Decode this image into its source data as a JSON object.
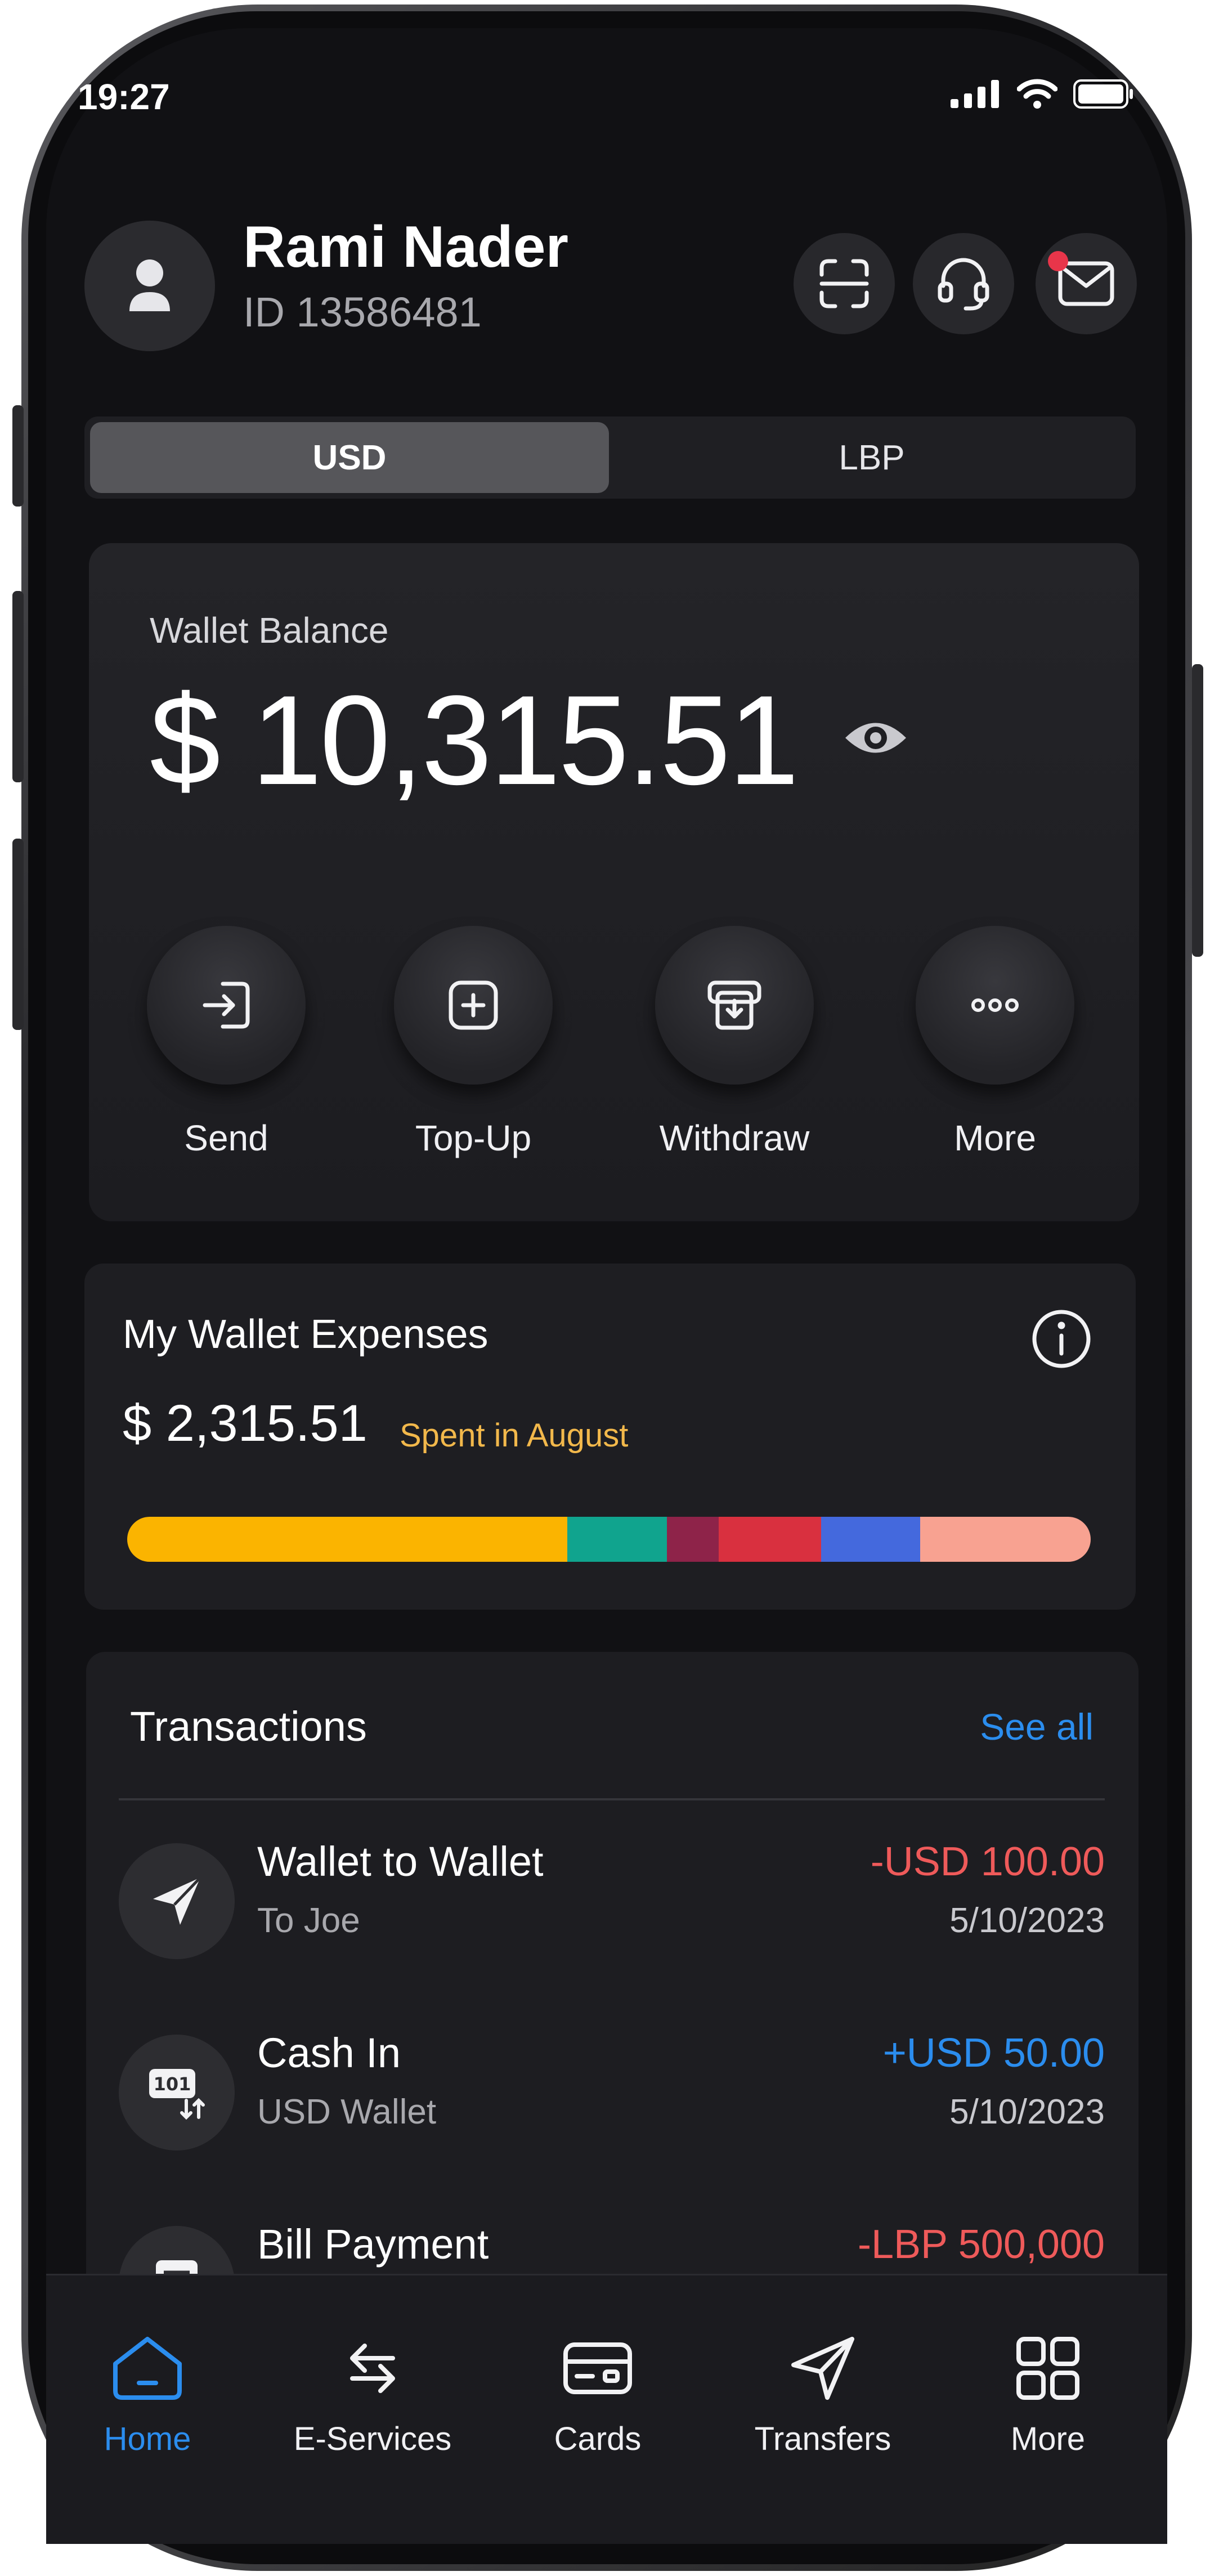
{
  "status_bar": {
    "time": "19:27"
  },
  "user": {
    "name": "Rami Nader",
    "id_text": "ID 13586481"
  },
  "header_buttons": [
    "scan-icon",
    "headset-icon",
    "mail-icon"
  ],
  "currency_tabs": {
    "selected": "USD",
    "items": [
      "USD",
      "LBP"
    ]
  },
  "wallet": {
    "label": "Wallet Balance",
    "balance": "$ 10,315.51",
    "actions": [
      {
        "label": "Send",
        "icon": "send-in-icon"
      },
      {
        "label": "Top-Up",
        "icon": "plus-square-icon"
      },
      {
        "label": "Withdraw",
        "icon": "atm-withdraw-icon"
      },
      {
        "label": "More",
        "icon": "more-dots-icon"
      }
    ]
  },
  "expenses": {
    "title": "My Wallet Expenses",
    "amount": "$ 2,315.51",
    "note": "Spent in August",
    "segments": [
      {
        "share": 0.457,
        "color": "#fbb400"
      },
      {
        "share": 0.103,
        "color": "#10a48e"
      },
      {
        "share": 0.054,
        "color": "#8e2349"
      },
      {
        "share": 0.106,
        "color": "#d9303f"
      },
      {
        "share": 0.103,
        "color": "#4469dd"
      },
      {
        "share": 0.177,
        "color": "#f8a291"
      }
    ]
  },
  "transactions": {
    "title": "Transactions",
    "see_all": "See all",
    "items": [
      {
        "name": "Wallet to Wallet",
        "sub": "To Joe",
        "amount": "-USD 100.00",
        "date": "5/10/2023",
        "icon": "paper-plane-icon",
        "color": "#ef5a5a"
      },
      {
        "name": "Cash In",
        "sub": "USD Wallet",
        "amount": "+USD 50.00",
        "date": "5/10/2023",
        "icon": "cash-in-icon",
        "color": "#2b8dee"
      },
      {
        "name": "Bill Payment",
        "sub": "",
        "amount": "-LBP 500,000",
        "date": "",
        "icon": "bill-icon",
        "color": "#ef5a5a"
      }
    ]
  },
  "bottom_nav": {
    "active": "Home",
    "items": [
      {
        "label": "Home",
        "icon": "home-icon"
      },
      {
        "label": "E-Services",
        "icon": "exchange-arrows-icon"
      },
      {
        "label": "Cards",
        "icon": "card-icon"
      },
      {
        "label": "Transfers",
        "icon": "paper-plane-icon"
      },
      {
        "label": "More",
        "icon": "grid-icon"
      }
    ]
  },
  "colors": {
    "accent_blue": "#2b8dee",
    "negative_red": "#ef5a5a",
    "highlight_yellow": "#f2b84b",
    "background": "#111114"
  }
}
